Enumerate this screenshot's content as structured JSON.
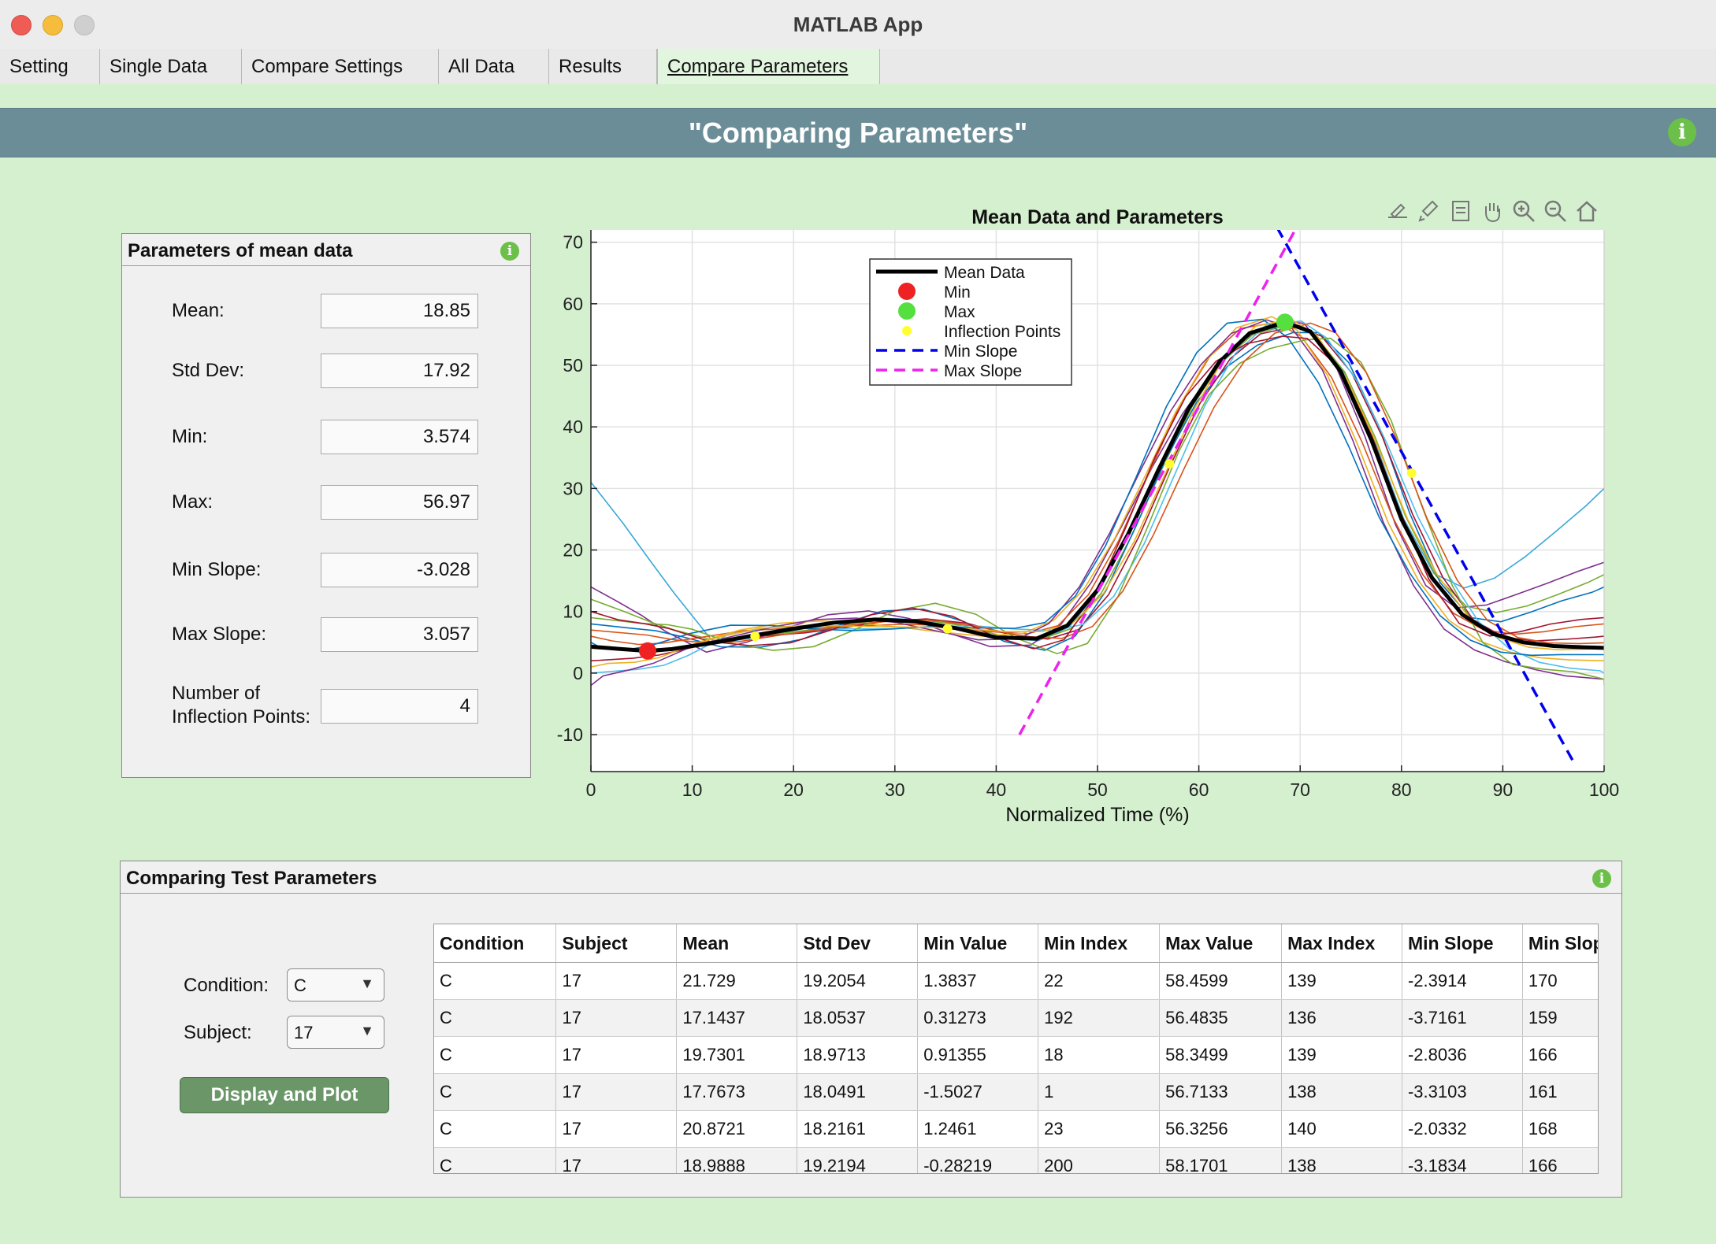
{
  "window": {
    "title": "MATLAB App"
  },
  "tabs": [
    "Setting",
    "Single Data",
    "Compare Settings",
    "All Data",
    "Results",
    "Compare Parameters"
  ],
  "active_tab": "Compare Parameters",
  "banner": {
    "title": "\"Comparing Parameters\""
  },
  "params_panel": {
    "title": "Parameters of mean data",
    "fields": [
      {
        "label": "Mean:",
        "value": "18.85"
      },
      {
        "label": "Std Dev:",
        "value": "17.92"
      },
      {
        "label": "Min:",
        "value": "3.574"
      },
      {
        "label": "Max:",
        "value": "56.97"
      },
      {
        "label": "Min Slope:",
        "value": "-3.028"
      },
      {
        "label": "Max Slope:",
        "value": "3.057"
      }
    ],
    "inflection_label_1": "Number of",
    "inflection_label_2": "Inflection Points:",
    "inflection_value": "4"
  },
  "toolbar_icons": [
    "export-icon",
    "brush-icon",
    "datatip-icon",
    "pan-icon",
    "zoom-in-icon",
    "zoom-out-icon",
    "home-icon"
  ],
  "chart_data": {
    "type": "line",
    "title": "Mean Data and Parameters",
    "xlabel": "Normalized Time (%)",
    "ylabel": "",
    "xlim": [
      0,
      100
    ],
    "ylim": [
      -16,
      72
    ],
    "xticks": [
      0,
      10,
      20,
      30,
      40,
      50,
      60,
      70,
      80,
      90,
      100
    ],
    "yticks": [
      -10,
      0,
      10,
      20,
      30,
      40,
      50,
      60,
      70
    ],
    "grid": true,
    "legend_position": "top-center",
    "legend": [
      "Mean Data",
      "Min",
      "Max",
      "Inflection Points",
      "Min Slope",
      "Max Slope"
    ],
    "colors": {
      "mean": "#000000",
      "min": "#ee2222",
      "max": "#55e040",
      "inflection": "#ffff30",
      "min_slope": "#0000ee",
      "max_slope": "#ee22ee"
    },
    "mean_series": {
      "x": [
        0,
        3,
        5.6,
        8,
        12,
        16,
        20,
        24,
        28,
        32,
        36,
        40,
        44,
        47,
        50,
        53,
        56,
        59,
        62,
        65,
        68.5,
        71,
        74,
        77,
        80,
        83,
        86,
        89,
        92,
        95,
        98,
        100
      ],
      "y": [
        4.3,
        3.9,
        3.6,
        3.9,
        4.9,
        6.1,
        7.2,
        8.2,
        8.7,
        8.4,
        7.3,
        5.8,
        5.6,
        7.7,
        13.5,
        22.5,
        33,
        43,
        50.5,
        55.2,
        57.0,
        55.5,
        49,
        38,
        25,
        15.5,
        9.5,
        6.4,
        5,
        4.4,
        4.2,
        4.1
      ]
    },
    "min_point": {
      "x": 5.6,
      "y": 3.6
    },
    "max_point": {
      "x": 68.5,
      "y": 57.0
    },
    "inflection_points": [
      {
        "x": 16.2,
        "y": 6.0
      },
      {
        "x": 35.2,
        "y": 7.2
      },
      {
        "x": 57.1,
        "y": 34.0
      },
      {
        "x": 81.0,
        "y": 32.5
      }
    ],
    "min_slope_line": {
      "x": [
        66,
        97
      ],
      "y": [
        77.5,
        -14.5
      ]
    },
    "max_slope_line": {
      "x": [
        42.3,
        71.5
      ],
      "y": [
        -10,
        78
      ]
    },
    "individual_trials": [
      {
        "color": "#3aa7d8",
        "dx": 0.2,
        "dy": 0.3,
        "start": 31,
        "end": 30
      },
      {
        "color": "#7e2f8e",
        "dx": -0.6,
        "dy": 1.5,
        "start": 14,
        "end": 18
      },
      {
        "color": "#77ac30",
        "dx": 0.4,
        "dy": -0.5,
        "start": 12,
        "end": 16
      },
      {
        "color": "#0072bd",
        "dx": 0.8,
        "dy": -2.0,
        "start": 8,
        "end": 14
      },
      {
        "color": "#d95319",
        "dx": -0.9,
        "dy": 1.0,
        "start": 6,
        "end": 8
      },
      {
        "color": "#a2142f",
        "dx": 1.1,
        "dy": 0.8,
        "start": 2,
        "end": 6
      },
      {
        "color": "#edb120",
        "dx": -1.3,
        "dy": -1.0,
        "start": 1,
        "end": 2
      },
      {
        "color": "#4dbeee",
        "dx": 1.6,
        "dy": -1.5,
        "start": 0,
        "end": 0
      },
      {
        "color": "#7e2f8e",
        "dx": -1.8,
        "dy": 0.5,
        "start": -2,
        "end": -1
      },
      {
        "color": "#77ac30",
        "dx": 2.0,
        "dy": -3.0,
        "start": 9,
        "end": -2
      },
      {
        "color": "#0072bd",
        "dx": -2.2,
        "dy": 1.8,
        "start": 5,
        "end": 3
      },
      {
        "color": "#d95319",
        "dx": 2.5,
        "dy": 0.2,
        "start": 7,
        "end": 5
      },
      {
        "color": "#a2142f",
        "dx": -0.3,
        "dy": 2.3,
        "start": 10,
        "end": 9
      },
      {
        "color": "#edb120",
        "dx": 0.6,
        "dy": -1.2,
        "start": 4,
        "end": 4
      }
    ]
  },
  "compare_panel": {
    "title": "Comparing Test Parameters",
    "condition_label": "Condition:",
    "condition_value": "C",
    "subject_label": "Subject:",
    "subject_value": "17",
    "button_label": "Display and Plot"
  },
  "table": {
    "columns": [
      "Condition",
      "Subject",
      "Mean",
      "Std Dev",
      "Min Value",
      "Min Index",
      "Max Value",
      "Max Index",
      "Min Slope",
      "Min Slope"
    ],
    "rows": [
      [
        "C",
        "17",
        "21.729",
        "19.2054",
        "1.3837",
        "22",
        "58.4599",
        "139",
        "-2.3914",
        "170"
      ],
      [
        "C",
        "17",
        "17.1437",
        "18.0537",
        "0.31273",
        "192",
        "56.4835",
        "136",
        "-3.7161",
        "159"
      ],
      [
        "C",
        "17",
        "19.7301",
        "18.9713",
        "0.91355",
        "18",
        "58.3499",
        "139",
        "-2.8036",
        "166"
      ],
      [
        "C",
        "17",
        "17.7673",
        "18.0491",
        "-1.5027",
        "1",
        "56.7133",
        "138",
        "-3.3103",
        "161"
      ],
      [
        "C",
        "17",
        "20.8721",
        "18.2161",
        "1.2461",
        "23",
        "56.3256",
        "140",
        "-2.0332",
        "168"
      ],
      [
        "C",
        "17",
        "18.9888",
        "19.2194",
        "-0.28219",
        "200",
        "58.1701",
        "138",
        "-3.1834",
        "166"
      ]
    ]
  }
}
